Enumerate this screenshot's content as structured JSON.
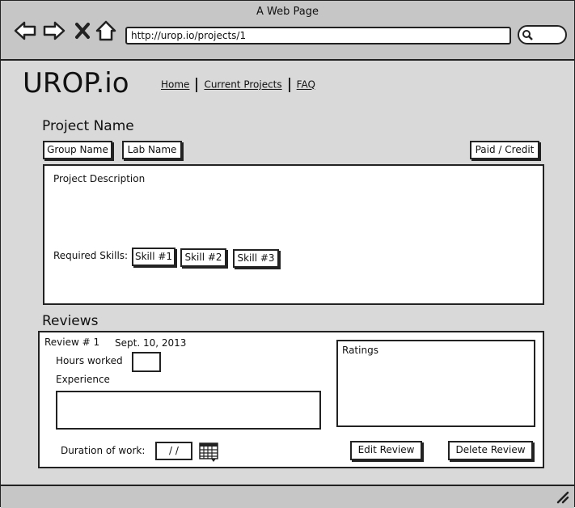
{
  "browser": {
    "window_title": "A Web Page",
    "url": "http://urop.io/projects/1"
  },
  "site": {
    "logo": "UROP.io",
    "nav": [
      "Home",
      "Current Projects",
      "FAQ"
    ]
  },
  "project": {
    "name": "Project Name",
    "group_label": "Group Name",
    "lab_label": "Lab Name",
    "paid_label": "Paid / Credit",
    "description_label": "Project Description",
    "skills_label": "Required Skills:",
    "skills": [
      "Skill #1",
      "Skill #2",
      "Skill #3"
    ]
  },
  "reviews": {
    "heading": "Reviews",
    "review_number": "Review # 1",
    "date": "Sept. 10, 2013",
    "hours_label": "Hours worked",
    "experience_label": "Experience",
    "duration_label": "Duration of work:",
    "duration_value": "/ /",
    "ratings_label": "Ratings",
    "edit_label": "Edit Review",
    "delete_label": "Delete Review"
  }
}
